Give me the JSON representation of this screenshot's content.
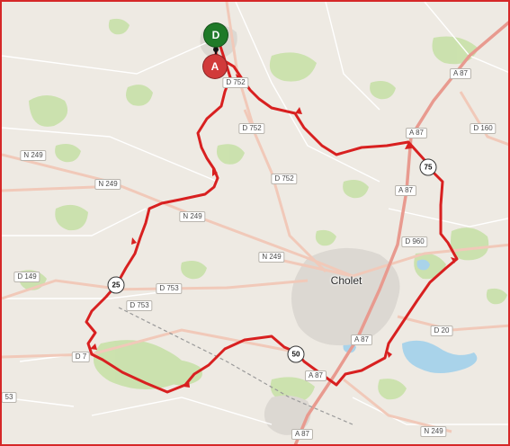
{
  "map": {
    "colors": {
      "background": "#eeeae3",
      "forest": "#c5e0a5",
      "water": "#a9d3ea",
      "urban": "#dcd8d2",
      "route": "#d82020",
      "motorway": "#e89a8f",
      "primary_road": "#f1c9b9",
      "frame": "#d62828"
    },
    "city": {
      "name": "Cholet"
    },
    "markers": {
      "start": {
        "label": "D",
        "color": "#1f7a28"
      },
      "end": {
        "label": "A",
        "color": "#d13a3a"
      }
    },
    "km_markers": [
      {
        "label": "25"
      },
      {
        "label": "50"
      },
      {
        "label": "75"
      }
    ],
    "road_labels": [
      "A 87",
      "A 87",
      "A 87",
      "A 87",
      "A 87",
      "A 87",
      "D 160",
      "D 752",
      "D 752",
      "N 249",
      "N 249",
      "N 249",
      "N 249",
      "N 249",
      "D 960",
      "D 753",
      "D 753",
      "D 149",
      "D 20",
      "D 7",
      "53",
      "D 752"
    ]
  }
}
